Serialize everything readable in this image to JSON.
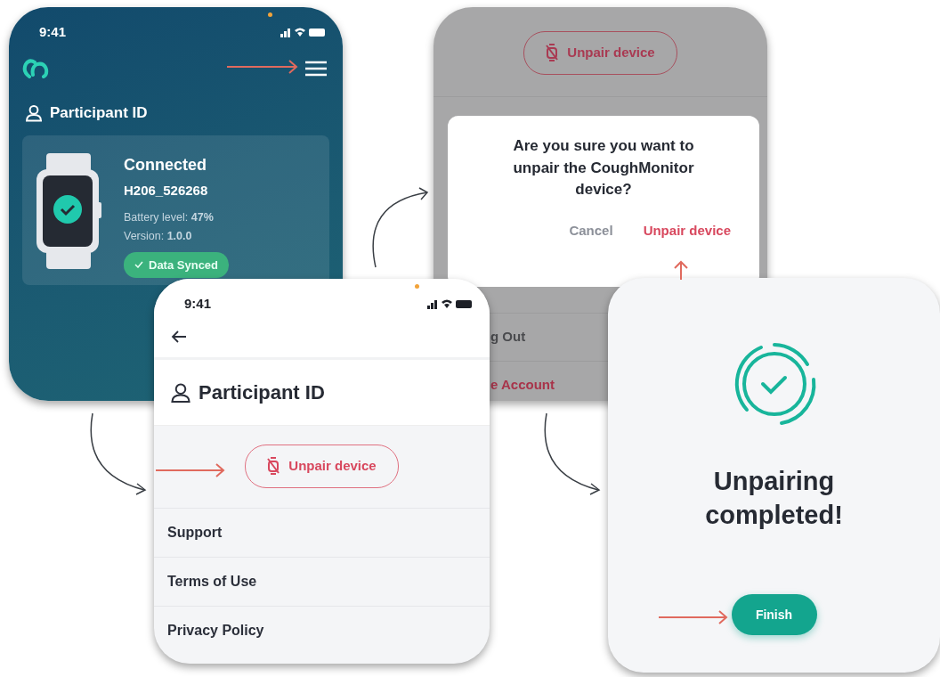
{
  "home_screen": {
    "time": "9:41",
    "participant": "Participant ID",
    "device": {
      "status": "Connected",
      "id": "H206_526268",
      "battery": "Battery level: **47%**",
      "version": "Version: **1.0.0**",
      "sync": "Data Synced"
    }
  },
  "confirm_screen": {
    "button": "Unpair device",
    "rows": [
      {
        "label": "g Out",
        "kind": "normal"
      },
      {
        "label": "e Account",
        "kind": "danger"
      }
    ],
    "dialog": {
      "question": "Are you sure you want to unpair the CoughMonitor device?",
      "cancel": "Cancel",
      "confirm": "Unpair device"
    }
  },
  "profile_screen": {
    "time": "9:41",
    "title": "Participant ID",
    "button": "Unpair device",
    "menu": [
      "Support",
      "Terms of Use",
      "Privacy Policy"
    ]
  },
  "done_screen": {
    "title": "Unpairing completed!",
    "button": "Finish"
  }
}
